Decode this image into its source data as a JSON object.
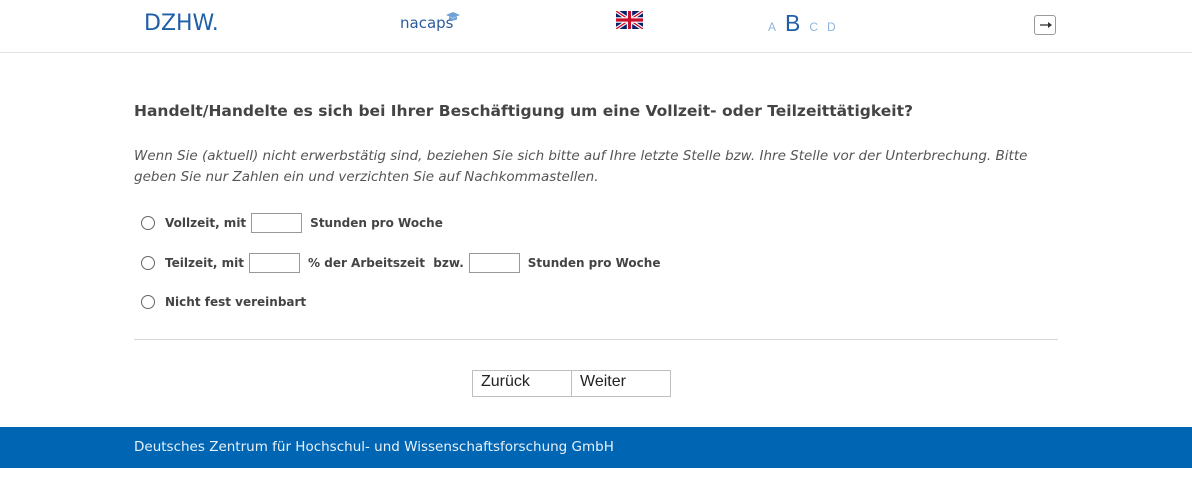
{
  "header": {
    "logo_dzhw": "DZHW.",
    "logo_nacaps": "nacaps",
    "language_flag": "uk-flag-icon",
    "font_sizes": [
      "A",
      "B",
      "C",
      "D"
    ],
    "font_size_active": "B",
    "logout_icon": "logout-icon"
  },
  "question": {
    "title": "Handelt/Handelte es sich bei Ihrer Beschäftigung um eine Vollzeit- oder Teilzeittätigkeit?",
    "instruction": "Wenn Sie (aktuell) nicht erwerbstätig sind, beziehen Sie sich bitte auf Ihre letzte Stelle bzw. Ihre Stelle vor der Unterbrechung. Bitte geben Sie nur Zahlen ein und verzichten Sie auf Nachkommastellen.",
    "options": {
      "vollzeit": {
        "prefix": "Vollzeit, mit",
        "suffix": "Stunden pro Woche",
        "value": ""
      },
      "teilzeit": {
        "prefix": "Teilzeit, mit",
        "middle": "% der Arbeitszeit  bzw.",
        "suffix": "Stunden pro Woche",
        "value_percent": "",
        "value_hours": ""
      },
      "nicht_fest": {
        "label": "Nicht fest vereinbart"
      }
    }
  },
  "navigation": {
    "back": "Zurück",
    "next": "Weiter"
  },
  "footer": {
    "text": "Deutsches Zentrum für Hochschul- und Wissenschaftsforschung GmbH"
  },
  "colors": {
    "brand_blue": "#1f5fa6",
    "footer_blue": "#0066b3"
  }
}
